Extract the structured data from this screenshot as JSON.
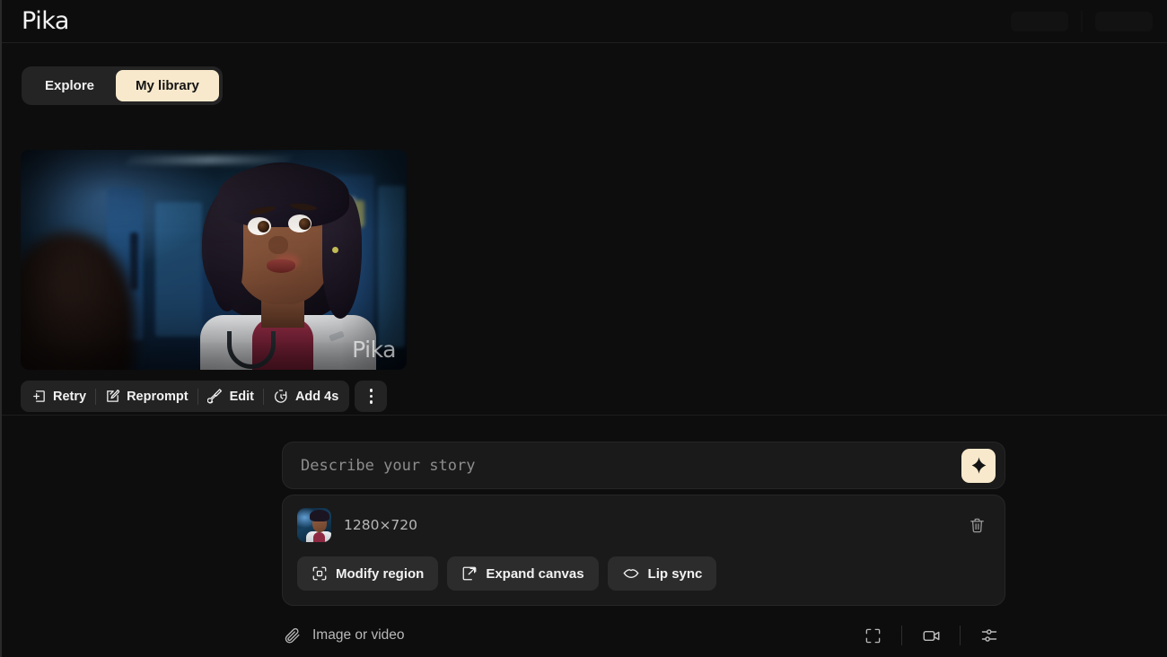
{
  "header": {
    "brand": "Pika"
  },
  "tabs": [
    {
      "label": "Explore",
      "active": false,
      "name": "tab-explore"
    },
    {
      "label": "My library",
      "active": true,
      "name": "tab-my-library"
    }
  ],
  "video_card": {
    "watermark": "Pika",
    "alt": "Animated 3D Black woman doctor in white lab coat with stethoscope, worried expression, blue-lit hospital corridor"
  },
  "action_bar": {
    "buttons": [
      {
        "label": "Retry",
        "icon": "add-frame-icon"
      },
      {
        "label": "Reprompt",
        "icon": "pencil-square-icon"
      },
      {
        "label": "Edit",
        "icon": "paintbrush-icon"
      },
      {
        "label": "Add 4s",
        "icon": "stopwatch-icon"
      }
    ],
    "more_menu": "more-options-icon"
  },
  "composer": {
    "prompt": {
      "value": "",
      "placeholder": "Describe your story"
    },
    "generate_button": "sparkle-icon",
    "attachment": {
      "resolution": "1280×720",
      "delete_icon": "trash-icon",
      "chips": [
        {
          "label": "Modify region",
          "icon": "modify-region-icon"
        },
        {
          "label": "Expand canvas",
          "icon": "expand-canvas-icon"
        },
        {
          "label": "Lip sync",
          "icon": "lips-icon"
        }
      ]
    },
    "bottom_bar": {
      "attach_label": "Image or video",
      "attach_icon": "paperclip-icon",
      "icons": [
        {
          "name": "aspect-ratio-icon"
        },
        {
          "name": "video-camera-icon"
        },
        {
          "name": "settings-sliders-icon"
        }
      ]
    }
  },
  "colors": {
    "page_bg": "#0d0d0d",
    "accent_cream": "#f8e9cc",
    "panel": "#1a1a1a",
    "chip": "#2c2c2c"
  }
}
